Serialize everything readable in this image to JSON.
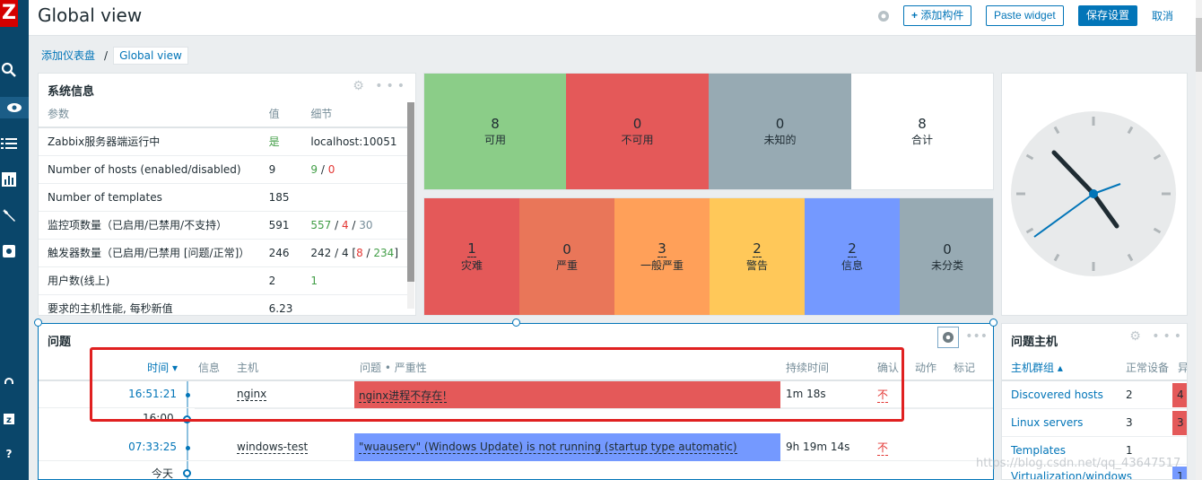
{
  "app": {
    "logo": "Z",
    "title": "Global view"
  },
  "header": {
    "add_widget": "添加构件",
    "paste_widget": "Paste widget",
    "save": "保存设置",
    "cancel": "取消"
  },
  "breadcrumb": {
    "parent": "添加仪表盘",
    "current": "Global view"
  },
  "sidebar": {
    "icons": [
      "search-icon",
      "eye-icon",
      "list-icon",
      "chart-icon",
      "wrench-icon",
      "gear-icon",
      "support-icon",
      "zabbix-share-icon",
      "help-icon"
    ]
  },
  "system_info": {
    "title": "系统信息",
    "headers": [
      "参数",
      "值",
      "细节"
    ],
    "rows": [
      {
        "param": "Zabbix服务器端运行中",
        "value": "是",
        "detail": "localhost:10051"
      },
      {
        "param": "Number of hosts (enabled/disabled)",
        "value": "9",
        "d1": "9",
        "d2": "0"
      },
      {
        "param": "Number of templates",
        "value": "185",
        "detail": ""
      },
      {
        "param": "监控项数量（已启用/已禁用/不支持）",
        "value": "591",
        "d1": "557",
        "d2": "4",
        "d3": "30"
      },
      {
        "param": "触发器数量（已启用/已禁用 [问题/正常]）",
        "value": "246",
        "d1": "242 / 4 [",
        "d2": "8",
        "d3": "234",
        "d4": "]"
      },
      {
        "param": "用户数(线上)",
        "value": "2",
        "d1": "1"
      },
      {
        "param": "要求的主机性能, 每秒新值",
        "value": "6.23",
        "detail": ""
      }
    ]
  },
  "host_availability": [
    {
      "count": "8",
      "label": "可用",
      "color": "#8bcd88"
    },
    {
      "count": "0",
      "label": "不可用",
      "color": "#e45959"
    },
    {
      "count": "0",
      "label": "未知的",
      "color": "#97aab3"
    },
    {
      "count": "8",
      "label": "合计",
      "color": "#ffffff"
    }
  ],
  "severity": [
    {
      "count": "1",
      "label": "灾难",
      "color": "#e45959"
    },
    {
      "count": "0",
      "label": "严重",
      "color": "#e97659"
    },
    {
      "count": "3",
      "label": "一般严重",
      "color": "#ffa059"
    },
    {
      "count": "2",
      "label": "警告",
      "color": "#ffc859"
    },
    {
      "count": "2",
      "label": "信息",
      "color": "#7499ff"
    },
    {
      "count": "0",
      "label": "未分类",
      "color": "#97aab3"
    }
  ],
  "problems": {
    "title": "问题",
    "headers": [
      "时间 ▾",
      "信息",
      "主机",
      "问题 • 严重性",
      "持续时间",
      "确认",
      "动作",
      "标记"
    ],
    "rows": [
      {
        "time": "16:51:21",
        "host": "nginx",
        "problem": "nginx进程不存在!",
        "duration": "1m 18s",
        "ack": "不",
        "color": "#e45959"
      },
      {
        "time": "07:33:25",
        "host": "windows-test",
        "problem": "\"wuauserv\" (Windows Update) is not running (startup type automatic)",
        "duration": "9h 19m 14s",
        "ack": "不",
        "color": "#7499ff"
      }
    ],
    "markers": [
      "16:00",
      "今天"
    ]
  },
  "problem_hosts": {
    "title": "问题主机",
    "headers": [
      "主机群组 ▴",
      "正常设备",
      "异"
    ],
    "rows": [
      {
        "group": "Discovered hosts",
        "ok": "2",
        "n": "4"
      },
      {
        "group": "Linux servers",
        "ok": "3",
        "n": "3"
      },
      {
        "group": "Templates",
        "ok": "1",
        "n": ""
      },
      {
        "group": "Virtualization/windows",
        "ok": "",
        "n": "1"
      }
    ]
  },
  "watermark": "https://blog.csdn.net/qq_43647517"
}
